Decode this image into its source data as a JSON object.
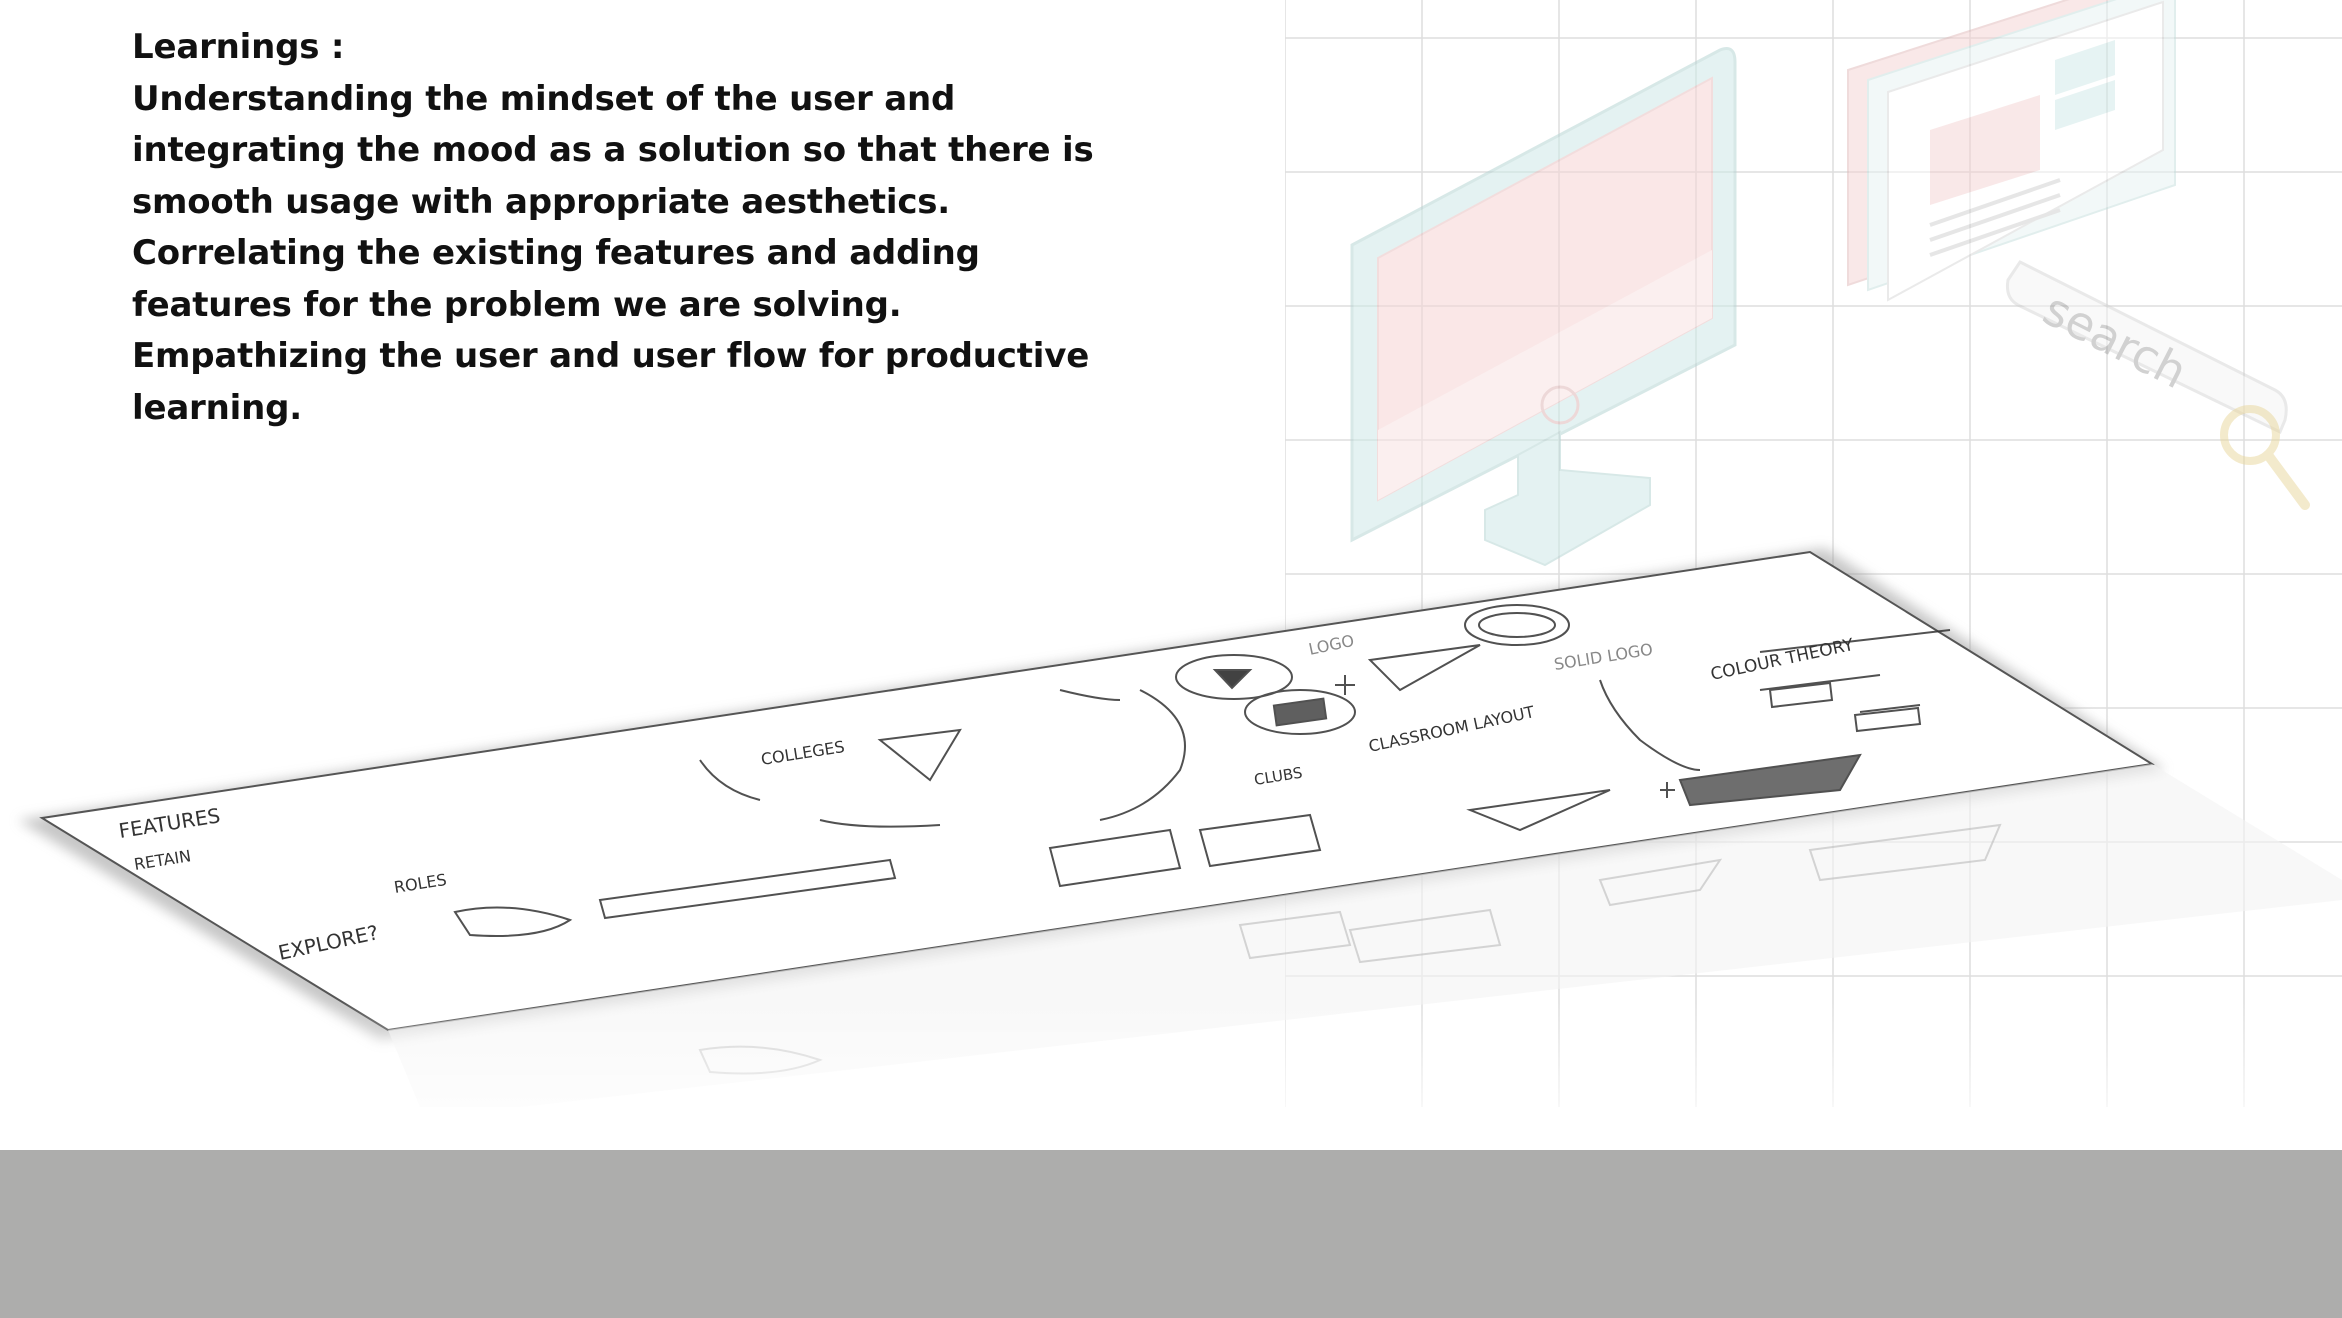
{
  "learnings": {
    "lines": [
      "Learnings :",
      "Understanding the mindset of the user and",
      "integrating the mood as a solution so that there is",
      "smooth usage with appropriate aesthetics.",
      "Correlating the existing features and adding",
      "features for the problem we are solving.",
      "Empathizing the user and user flow for productive",
      "learning."
    ]
  },
  "illustration": {
    "search_bar_label": "search",
    "sketch_labels": {
      "features": "FEATURES",
      "retain": "RETAIN",
      "explore": "EXPLORE?",
      "roles": "ROLES",
      "colleges": "COLLEGES",
      "colour_theory": "COLOUR THEORY",
      "clubs": "CLUBS",
      "classroom_layout": "CLASSROOM LAYOUT",
      "logo": "LOGO",
      "solid_logo": "SOLID LOGO"
    },
    "icons": [
      "monitor-icon",
      "browser-windows-icon",
      "search-bar-icon",
      "magnifier-icon"
    ],
    "colors": {
      "grid_line": "#d9d9d9",
      "monitor_screen": "#f6d5d5",
      "monitor_frame": "#cfe9e8",
      "footer": "#adadac",
      "text": "#111111"
    }
  }
}
